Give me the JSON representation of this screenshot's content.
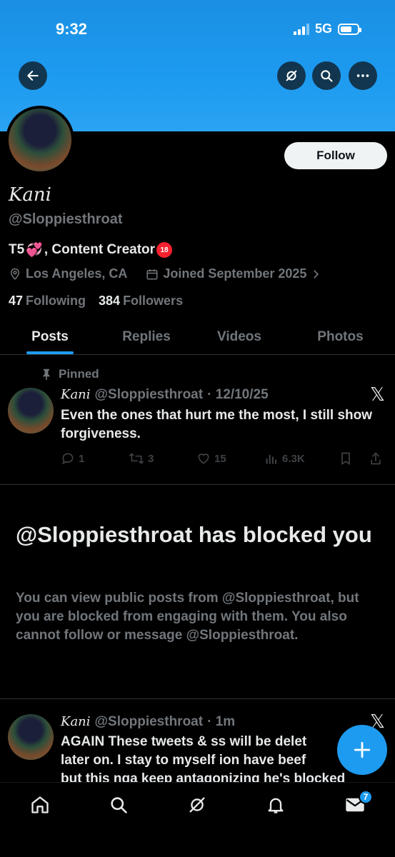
{
  "status_bar": {
    "time": "9:32",
    "network": "5G"
  },
  "profile": {
    "display_name": "Kani",
    "handle": "@Sloppiesthroat",
    "follow_label": "Follow",
    "bio_prefix": "T5",
    "bio_suffix": ", Content Creator",
    "location": "Los Angeles, CA",
    "joined": "Joined September 2025",
    "following_count": "47",
    "following_label": "Following",
    "followers_count": "384",
    "followers_label": "Followers"
  },
  "tabs": [
    {
      "label": "Posts",
      "active": true
    },
    {
      "label": "Replies",
      "active": false
    },
    {
      "label": "Videos",
      "active": false
    },
    {
      "label": "Photos",
      "active": false
    }
  ],
  "pinned_tweet": {
    "pinned_label": "Pinned",
    "name": "Kani",
    "handle": "@Sloppiesthroat",
    "date": "· 12/10/25",
    "text": "Even the ones that hurt me the most, I still show forgiveness.",
    "replies": "1",
    "retweets": "3",
    "likes": "15",
    "views": "6.3K"
  },
  "blocked": {
    "title": "@Sloppiesthroat has blocked you",
    "text": "You can view public posts from @Sloppiesthroat, but you are blocked from engaging with them. You also cannot follow or message @Sloppiesthroat."
  },
  "second_tweet": {
    "name": "Kani",
    "handle": "@Sloppiesthroat",
    "date": "· 1m",
    "text_line1": "AGAIN These tweets & ss will be delet",
    "text_line2": "later on. I stay to myself ion have beef",
    "text_line3": "but this nga keep antagonizing he's blocked"
  },
  "nav": {
    "messages_badge": "7"
  },
  "colors": {
    "accent": "#1d9bf0",
    "banner": "#1d9bf0",
    "background": "#000000",
    "muted": "#71767b"
  }
}
